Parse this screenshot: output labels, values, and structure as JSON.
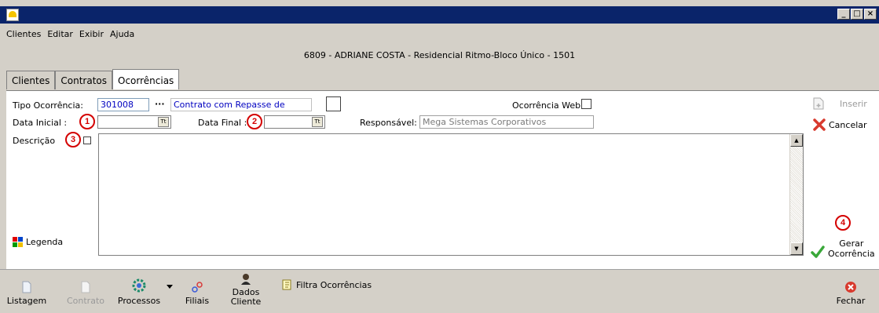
{
  "window": {
    "title": "",
    "controls": {
      "minimize": "_",
      "maximize": "□",
      "close": "×"
    }
  },
  "menu": [
    "Clientes",
    "Editar",
    "Exibir",
    "Ajuda"
  ],
  "header": {
    "record": "6809 - ADRIANE COSTA - Residencial Ritmo-Bloco Único - 1501"
  },
  "tabs": [
    "Clientes",
    "Contratos",
    "Ocorrências"
  ],
  "active_tab": "Ocorrências",
  "form": {
    "tipo_label": "Tipo Ocorrência:",
    "tipo_code": "301008",
    "tipo_ellipsis": "···",
    "tipo_desc": "Contrato com Repasse de",
    "web_label": "Ocorrência Web",
    "data_inicial_label": "Data Inicial :",
    "data_final_label": "Data Final :",
    "responsavel_label": "Responsável:",
    "responsavel_value": "Mega Sistemas Corporativos",
    "descricao_label": "Descrição",
    "legenda_label": "Legenda",
    "date_icon_text": "Tt"
  },
  "markers": [
    "1",
    "2",
    "3",
    "4"
  ],
  "actions": {
    "inserir": "Inserir",
    "cancelar": "Cancelar",
    "gerar_line1": "Gerar",
    "gerar_line2": "Ocorrência"
  },
  "toolbar": {
    "listagem": "Listagem",
    "contrato": "Contrato",
    "processos": "Processos",
    "filiais": "Filiais",
    "dados_line1": "Dados",
    "dados_line2": "Cliente",
    "filtra": "Filtra Ocorrências",
    "fechar": "Fechar"
  },
  "colors": {
    "titlebar": "#0a246a",
    "marker": "#d40000",
    "link_text": "#0000c0",
    "window_bg": "#d4d0c8"
  },
  "icons": [
    "app-icon",
    "calendar-icon",
    "insert-icon",
    "cancel-x-icon",
    "checkmark-icon",
    "legend-grid-icon",
    "document-icon",
    "contract-icon",
    "processes-icon",
    "branches-icon",
    "client-data-icon",
    "filter-icon",
    "close-icon"
  ]
}
